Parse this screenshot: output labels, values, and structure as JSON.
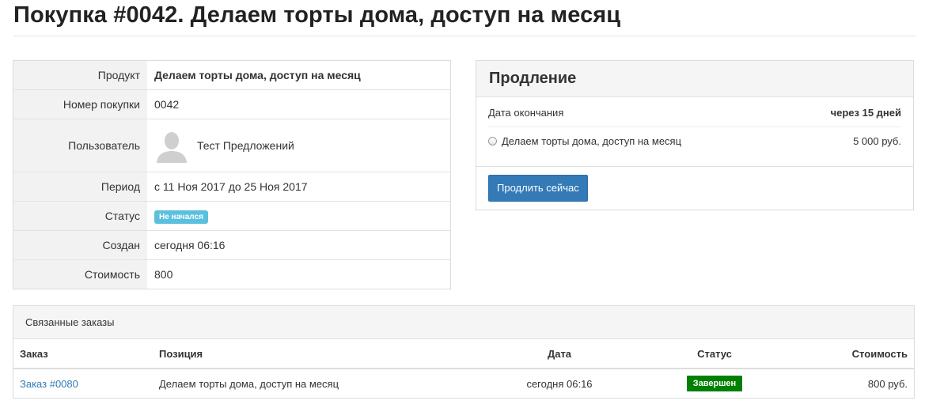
{
  "page": {
    "title": "Покупка #0042. Делаем торты дома, доступ на месяц"
  },
  "details": {
    "product_label": "Продукт",
    "product_value": "Делаем торты дома, доступ на месяц",
    "number_label": "Номер покупки",
    "number_value": "0042",
    "user_label": "Пользователь",
    "user_name": "Тест Предложений",
    "period_label": "Период",
    "period_value": "с 11 Ноя 2017 до 25 Ноя 2017",
    "status_label": "Статус",
    "status_value": "Не начался",
    "created_label": "Создан",
    "created_value": "сегодня 06:16",
    "cost_label": "Стоимость",
    "cost_value": "800"
  },
  "renewal": {
    "title": "Продление",
    "end_label": "Дата окончания",
    "end_value": "через 15 дней",
    "option_label": "Делаем торты дома, доступ на месяц",
    "option_price": "5 000 руб.",
    "button_label": "Продлить сейчас"
  },
  "orders": {
    "title": "Связанные заказы",
    "columns": [
      "Заказ",
      "Позиция",
      "Дата",
      "Статус",
      "Стоимость"
    ],
    "rows": [
      {
        "order": "Заказ #0080",
        "item": "Делаем торты дома, доступ на месяц",
        "date": "сегодня 06:16",
        "status": "Завершен",
        "cost": "800 руб."
      }
    ]
  },
  "colors": {
    "primary": "#337ab7",
    "info": "#5bc0de",
    "success": "#008000"
  }
}
